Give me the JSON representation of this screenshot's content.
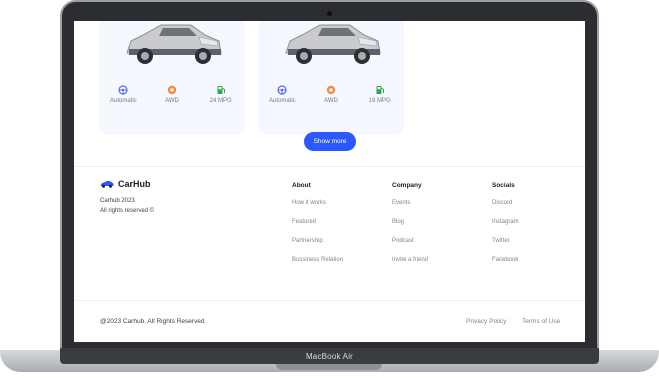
{
  "device": {
    "label": "MacBook Air"
  },
  "cars": [
    {
      "specs": [
        {
          "icon": "steering-wheel-icon",
          "label": "Automatic"
        },
        {
          "icon": "tire-icon",
          "label": "AWD"
        },
        {
          "icon": "fuel-pump-icon",
          "label": "24 MPG"
        }
      ]
    },
    {
      "specs": [
        {
          "icon": "steering-wheel-icon",
          "label": "Automatic"
        },
        {
          "icon": "tire-icon",
          "label": "AWD"
        },
        {
          "icon": "fuel-pump-icon",
          "label": "19 MPG"
        }
      ]
    }
  ],
  "show_more": {
    "label": "Show more"
  },
  "footer": {
    "brand": {
      "name": "CarHub",
      "line1": "Carhub 2023",
      "line2": "All rights reserved ©"
    },
    "columns": [
      {
        "title": "About",
        "links": [
          "How it works",
          "Featured",
          "Partnership",
          "Bussiness Relation"
        ]
      },
      {
        "title": "Company",
        "links": [
          "Events",
          "Blog",
          "Podcast",
          "Invite a friend"
        ]
      },
      {
        "title": "Socials",
        "links": [
          "Discord",
          "Instagram",
          "Twitter",
          "Facebook"
        ]
      }
    ],
    "copyright": "@2023 Carhub. All Rights Reserved",
    "legal": [
      "Privacy Policy",
      "Terms of Use"
    ]
  },
  "colors": {
    "accent": "#2b59ff",
    "card_bg": "#f5f8ff",
    "steering": "#5b6be0",
    "tire": "#f28b3b",
    "fuel": "#2fa84f"
  }
}
